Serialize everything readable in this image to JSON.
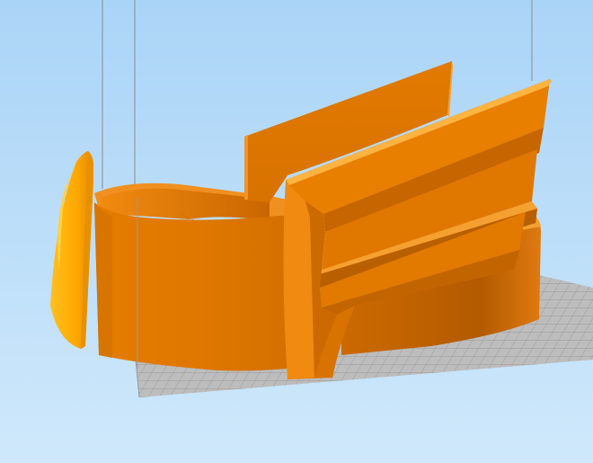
{
  "viewport": {
    "background_top": "#aad4f7",
    "background_bottom": "#cfe8fb"
  },
  "build_plate": {
    "fill": "#bdbdbd",
    "grid_line": "#8a8a8a",
    "border": "#9a9a9a"
  },
  "model": {
    "color_base": "#e67e00",
    "color_light": "#f5a623",
    "color_mid": "#d97300",
    "color_dark": "#b85f00",
    "color_darker": "#a55400",
    "color_highlight": "#ffb340",
    "color_emblem": "#ffb000",
    "parts": [
      "cuff-band",
      "wing-back",
      "wing-front",
      "emblem-disc"
    ]
  },
  "guide_lines": {
    "color": "#8c8c8c"
  }
}
